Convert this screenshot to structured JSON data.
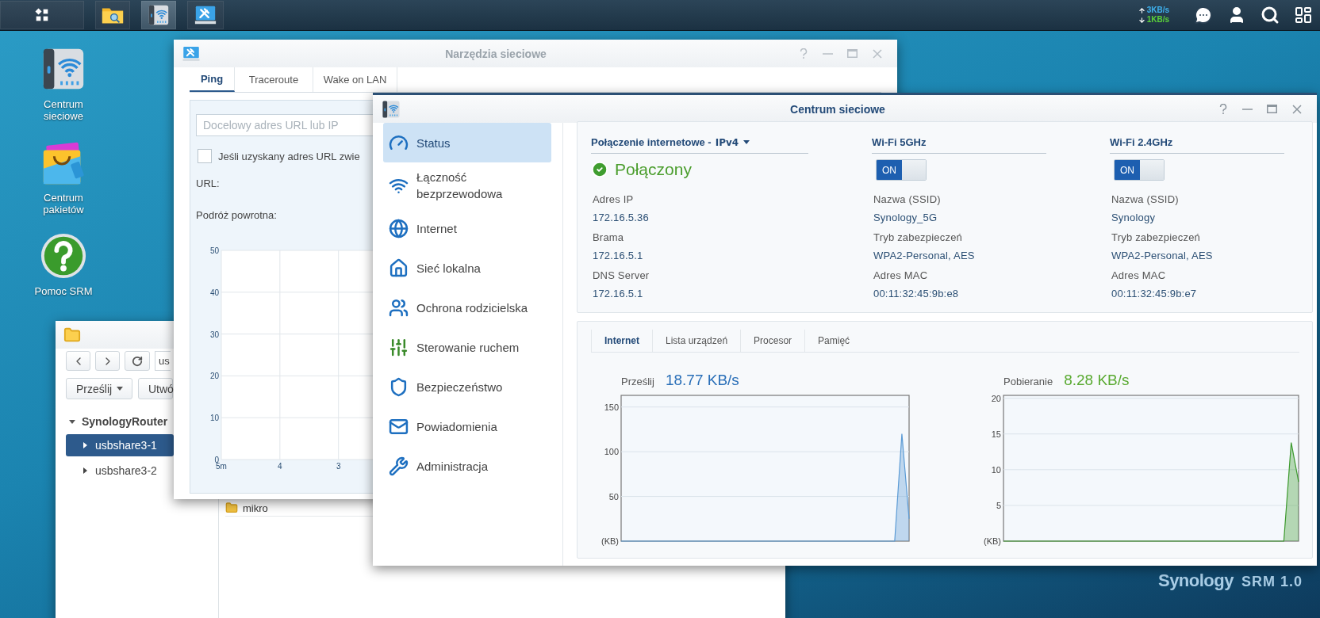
{
  "taskbar": {
    "apps": [
      {
        "kind": "menu",
        "selected": false
      },
      {
        "kind": "files",
        "selected": false
      },
      {
        "kind": "network",
        "selected": true
      },
      {
        "kind": "tools",
        "selected": false
      }
    ],
    "upload": "3KB/s",
    "download": "1KB/s"
  },
  "desktop_icons": [
    {
      "kind": "network",
      "label": "Centrum sieciowe"
    },
    {
      "kind": "packages",
      "label": "Centrum pakietów"
    },
    {
      "kind": "help",
      "label": "Pomoc SRM"
    }
  ],
  "file_station": {
    "path": "us",
    "buttons": [
      {
        "label": "Prześlij",
        "dropdown": true
      },
      {
        "label": "Utwó",
        "dropdown": false
      }
    ],
    "tree": {
      "label": "SynologyRouter",
      "expanded": true,
      "children": [
        {
          "label": "usbshare3-1",
          "selected": true,
          "expanded": false
        },
        {
          "label": "usbshare3-2",
          "selected": false,
          "expanded": false
        }
      ]
    },
    "files": [
      {
        "name": "mikro"
      }
    ]
  },
  "network_tools": {
    "title": "Narzędzia sieciowe",
    "tabs": [
      {
        "label": "Ping",
        "selected": true
      },
      {
        "label": "Traceroute",
        "selected": false
      },
      {
        "label": "Wake on LAN",
        "selected": false
      }
    ],
    "target_placeholder": "Docelowy adres URL lub IP",
    "option": {
      "label": "Jeśli uzyskany adres URL zwie",
      "checked": false
    },
    "url_label": "URL:",
    "rtt_label": "Podróż powrotna:",
    "chart_data": {
      "type": "line",
      "grid": true,
      "xlim": [
        5,
        2.4
      ],
      "ylim": [
        0,
        50
      ],
      "yticks": [
        0,
        10,
        20,
        30,
        40,
        50
      ],
      "xticks": [
        {
          "value": 5,
          "label": "5m"
        },
        {
          "value": 4,
          "label": "4"
        },
        {
          "value": 3,
          "label": "3"
        }
      ]
    }
  },
  "network_center": {
    "title": "Centrum sieciowe",
    "sidebar": [
      {
        "kind": "status",
        "label": "Status",
        "selected": true
      },
      {
        "kind": "wireless",
        "label": "Łączność bezprzewodowa",
        "selected": false
      },
      {
        "kind": "internet",
        "label": "Internet",
        "selected": false
      },
      {
        "kind": "local",
        "label": "Sieć lokalna",
        "selected": false
      },
      {
        "kind": "parental",
        "label": "Ochrona rodzicielska",
        "selected": false
      },
      {
        "kind": "traffic",
        "label": "Sterowanie ruchem",
        "selected": false
      },
      {
        "kind": "security",
        "label": "Bezpieczeństwo",
        "selected": false
      },
      {
        "kind": "notifications",
        "label": "Powiadomienia",
        "selected": false
      },
      {
        "kind": "admin",
        "label": "Administracja",
        "selected": false
      }
    ],
    "internet": {
      "title": "Połączenie internetowe -",
      "mode": "IPv4",
      "status": "Połączony",
      "connected": true,
      "fields": [
        {
          "label": "Adres IP",
          "value": "172.16.5.36"
        },
        {
          "label": "Brama",
          "value": "172.16.5.1"
        },
        {
          "label": "DNS Server",
          "value": "172.16.5.1"
        }
      ]
    },
    "wifi": [
      {
        "title": "Wi-Fi 5GHz",
        "on": true,
        "switch_label": "ON",
        "fields": [
          {
            "label": "Nazwa (SSID)",
            "value": "Synology_5G"
          },
          {
            "label": "Tryb zabezpieczeń",
            "value": "WPA2-Personal, AES"
          },
          {
            "label": "Adres MAC",
            "value": "00:11:32:45:9b:e8"
          }
        ]
      },
      {
        "title": "Wi-Fi 2.4GHz",
        "on": true,
        "switch_label": "ON",
        "fields": [
          {
            "label": "Nazwa (SSID)",
            "value": "Synology"
          },
          {
            "label": "Tryb zabezpieczeń",
            "value": "WPA2-Personal, AES"
          },
          {
            "label": "Adres MAC",
            "value": "00:11:32:45:9b:e7"
          }
        ]
      }
    ],
    "tabs": [
      {
        "label": "Internet",
        "selected": true
      },
      {
        "label": "Lista urządzeń",
        "selected": false
      },
      {
        "label": "Procesor",
        "selected": false
      },
      {
        "label": "Pamięć",
        "selected": false
      }
    ],
    "upload": {
      "label": "Prześlij",
      "value": "18.77 KB/s",
      "color": "#2a6fb8",
      "chart_data": {
        "type": "area",
        "grid": true,
        "ylim": [
          0,
          163
        ],
        "yticks": [
          {
            "value": 0,
            "label": "(KB)"
          },
          50,
          100,
          150
        ],
        "series": [
          {
            "color": "#5b9bd5",
            "values": [
              0,
              0,
              0,
              0,
              0,
              0,
              0,
              0,
              0,
              0,
              0,
              0,
              0,
              0,
              0,
              0,
              0,
              0,
              0,
              0,
              0,
              0,
              0,
              0,
              0,
              0,
              0,
              0,
              0,
              0,
              0,
              0,
              0,
              0,
              0,
              0,
              0,
              0,
              0,
              120,
              25
            ]
          }
        ]
      }
    },
    "download": {
      "label": "Pobieranie",
      "value": "8.28 KB/s",
      "color": "#5aaa32",
      "chart_data": {
        "type": "area",
        "grid": true,
        "ylim": [
          0,
          20.4
        ],
        "yticks": [
          {
            "value": 0,
            "label": "(KB)"
          },
          5,
          10,
          15,
          20
        ],
        "series": [
          {
            "color": "#3d9a2e",
            "values": [
              0,
              0,
              0,
              0,
              0,
              0,
              0,
              0,
              0,
              0,
              0,
              0,
              0,
              0,
              0,
              0,
              0,
              0,
              0,
              0,
              0,
              0,
              0,
              0,
              0,
              0,
              0,
              0,
              0,
              0,
              0,
              0,
              0,
              0,
              0,
              0,
              0,
              0,
              0,
              13.8,
              8.3
            ]
          }
        ]
      }
    }
  },
  "brand": {
    "name": "Synology",
    "product": "SRM 1.0"
  }
}
